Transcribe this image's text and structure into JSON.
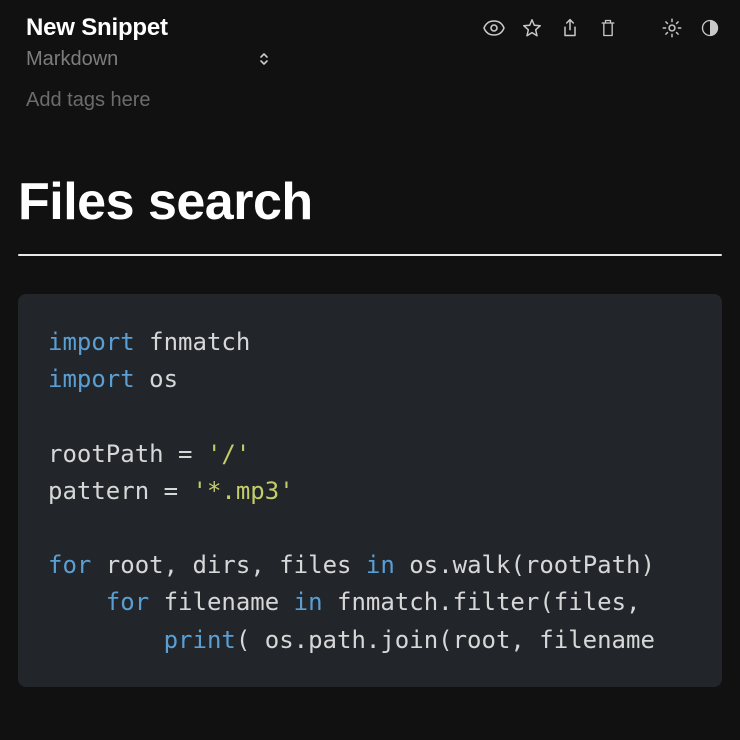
{
  "header": {
    "title": "New Snippet",
    "language": "Markdown"
  },
  "tags": {
    "placeholder": "Add tags here"
  },
  "icons": {
    "preview": "preview",
    "star": "star",
    "share": "share",
    "trash": "trash",
    "settings": "settings",
    "theme": "theme"
  },
  "document": {
    "heading": "Files search"
  },
  "code": {
    "tokens": [
      [
        [
          "kw",
          "import"
        ],
        [
          "id",
          " fnmatch"
        ]
      ],
      [
        [
          "kw",
          "import"
        ],
        [
          "id",
          " os"
        ]
      ],
      [],
      [
        [
          "id",
          "rootPath "
        ],
        [
          "pn",
          "="
        ],
        [
          "id",
          " "
        ],
        [
          "str",
          "'/'"
        ]
      ],
      [
        [
          "id",
          "pattern "
        ],
        [
          "pn",
          "="
        ],
        [
          "id",
          " "
        ],
        [
          "str",
          "'*.mp3'"
        ]
      ],
      [],
      [
        [
          "kw",
          "for"
        ],
        [
          "id",
          " root"
        ],
        [
          "pn",
          ","
        ],
        [
          "id",
          " dirs"
        ],
        [
          "pn",
          ","
        ],
        [
          "id",
          " files "
        ],
        [
          "kw",
          "in"
        ],
        [
          "id",
          " os"
        ],
        [
          "pn",
          "."
        ],
        [
          "id",
          "walk"
        ],
        [
          "pn",
          "("
        ],
        [
          "id",
          "rootPath"
        ],
        [
          "pn",
          ")"
        ]
      ],
      [
        [
          "id",
          "    "
        ],
        [
          "kw",
          "for"
        ],
        [
          "id",
          " filename "
        ],
        [
          "kw",
          "in"
        ],
        [
          "id",
          " fnmatch"
        ],
        [
          "pn",
          "."
        ],
        [
          "id",
          "filter"
        ],
        [
          "pn",
          "("
        ],
        [
          "id",
          "files"
        ],
        [
          "pn",
          ","
        ]
      ],
      [
        [
          "id",
          "        "
        ],
        [
          "kw",
          "print"
        ],
        [
          "pn",
          "("
        ],
        [
          "id",
          " os"
        ],
        [
          "pn",
          "."
        ],
        [
          "id",
          "path"
        ],
        [
          "pn",
          "."
        ],
        [
          "id",
          "join"
        ],
        [
          "pn",
          "("
        ],
        [
          "id",
          "root"
        ],
        [
          "pn",
          ","
        ],
        [
          "id",
          " filename"
        ]
      ]
    ]
  }
}
